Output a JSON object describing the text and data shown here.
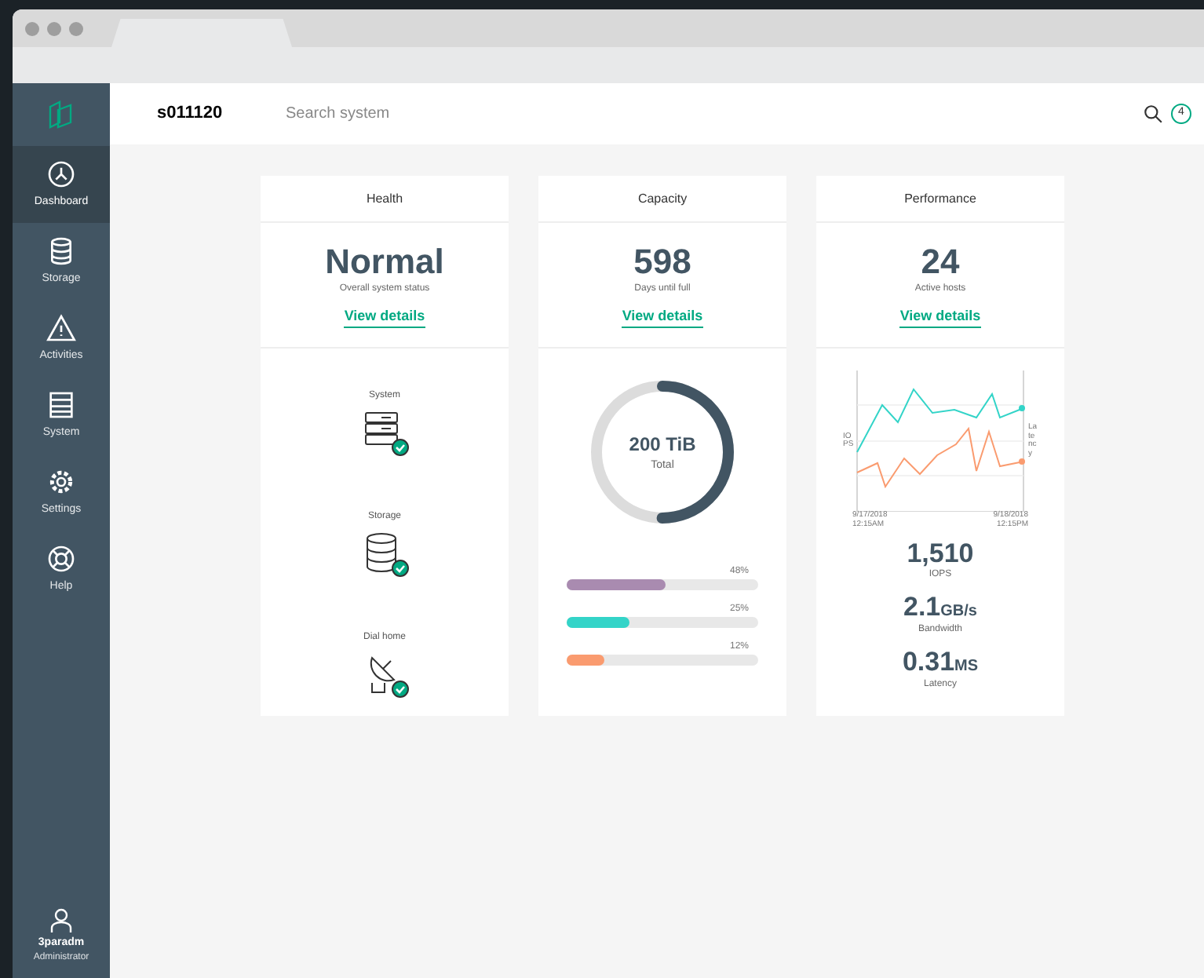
{
  "header": {
    "system_name": "s011120",
    "search": {
      "placeholder": "Search system"
    },
    "notifications": "4"
  },
  "sidebar": {
    "items": [
      {
        "label": "Dashboard",
        "kind": "dashboard",
        "selected": true
      },
      {
        "label": "Storage",
        "kind": "storage",
        "selected": false
      },
      {
        "label": "Activities",
        "kind": "activities",
        "selected": false
      },
      {
        "label": "System",
        "kind": "system",
        "selected": false
      },
      {
        "label": "Settings",
        "kind": "settings",
        "selected": false
      },
      {
        "label": "Help",
        "kind": "help",
        "selected": false
      }
    ],
    "user": {
      "name": "3paradm",
      "role": "Administrator"
    }
  },
  "cards": [
    {
      "kind": "health",
      "title": "Health",
      "value": "Normal",
      "caption": "Overall system status",
      "link": "View details",
      "items": [
        {
          "label": "System",
          "kind": "system"
        },
        {
          "label": "Storage",
          "kind": "storage"
        },
        {
          "label": "Dial home",
          "kind": "dish"
        }
      ]
    },
    {
      "kind": "capacity",
      "title": "Capacity",
      "value": "598",
      "caption": "Days until full",
      "link": "View details",
      "donut": {
        "level": 0.5,
        "value": "200 TiB",
        "label": "Total"
      },
      "bars": [
        {
          "reading": "48%",
          "level": 0.52,
          "color": "#a98bb0"
        },
        {
          "reading": "25%",
          "level": 0.33,
          "color": "#33d4c8"
        },
        {
          "reading": "12%",
          "level": 0.2,
          "color": "#fa9b6f"
        }
      ]
    },
    {
      "kind": "performance",
      "title": "Performance",
      "value": "24",
      "caption": "Active hosts",
      "link": "View details",
      "chart": {
        "y_left": "IOPS",
        "y_right": "Latency",
        "x_start": "9/17/2018 12:15AM",
        "x_end": "9/18/2018 12:15PM"
      },
      "metrics": [
        {
          "value": "1,510",
          "label": "IOPS"
        },
        {
          "value": "2.1",
          "unit": "GB/s",
          "label": "Bandwidth"
        },
        {
          "value": "0.31",
          "unit": "MS",
          "label": "Latency"
        }
      ]
    }
  ]
}
